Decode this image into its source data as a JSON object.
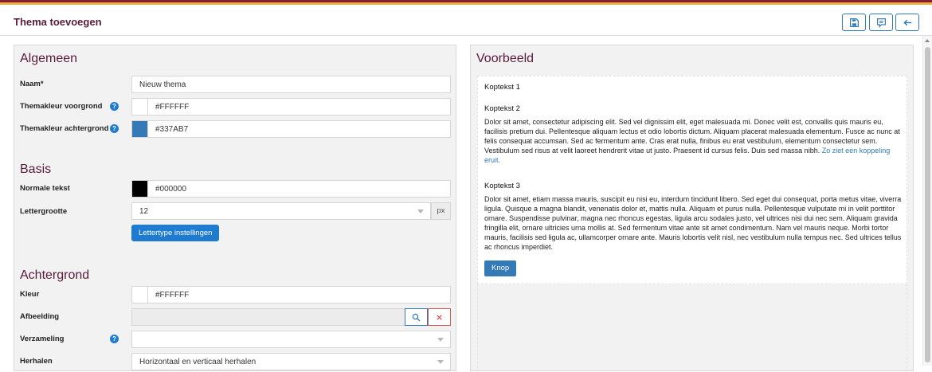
{
  "header": {
    "title": "Thema toevoegen",
    "buttons": [
      {
        "icon": "save-icon"
      },
      {
        "icon": "comment-icon"
      },
      {
        "icon": "arrow-left-icon"
      }
    ]
  },
  "colors": {
    "accent": "#337ab7",
    "title": "#5a1a3a",
    "primary_button": "#1f7bd0",
    "remove": "#d9534f"
  },
  "left_panel": {
    "algemeen": {
      "title": "Algemeen",
      "naam_label": "Naam*",
      "naam_value": "Nieuw thema",
      "voorgrond_label": "Themakleur voorgrond",
      "voorgrond_value": "#FFFFFF",
      "achtergrond_label": "Themakleur achtergrond",
      "achtergrond_value": "#337AB7"
    },
    "basis": {
      "title": "Basis",
      "normale_tekst_label": "Normale tekst",
      "normale_tekst_value": "#000000",
      "lettergrootte_label": "Lettergrootte",
      "lettergrootte_value": "12",
      "lettergrootte_unit": "px",
      "font_button": "Lettertype instellingen"
    },
    "achtergrond": {
      "title": "Achtergrond",
      "kleur_label": "Kleur",
      "kleur_value": "#FFFFFF",
      "afbeelding_label": "Afbeelding",
      "afbeelding_value": "",
      "verzameling_label": "Verzameling",
      "verzameling_value": "",
      "herhalen_label": "Herhalen",
      "herhalen_value": "Horizontaal en verticaal herhalen"
    },
    "help_glyph": "?"
  },
  "right_panel": {
    "title": "Voorbeeld",
    "koptekst1": "Koptekst 1",
    "koptekst2": "Koptekst 2",
    "paragraph1": "Dolor sit amet, consectetur adipiscing elit. Sed vel dignissim elit, eget malesuada mi. Donec velit est, convallis quis mauris eu, facilisis pretium dui. Pellentesque aliquam lectus et odio lobortis dictum. Aliquam placerat malesuada elementum. Fusce ac nunc at felis consequat accumsan. Sed ac fermentum ante. Cras erat nulla, finibus eu erat vestibulum, elementum consectetur sem. Vestibulum sed risus at velit laoreet hendrerit vitae ut justo. Praesent id cursus felis. Duis sed massa nibh.",
    "link_text": "Zo ziet een koppeling eruit.",
    "koptekst3": "Koptekst 3",
    "paragraph2": "Dolor sit amet, etiam massa mauris, suscipit eu nisi eu, interdum tincidunt libero. Sed eget dui consequat, porta metus vitae, viverra ligula. Quisque a magna blandit, venenatis dolor et, mattis nulla. Aliquam et purus nulla. Pellentesque vulputate mi in velit porttitor ornare. Suspendisse pulvinar, magna nec rhoncus egestas, ligula arcu sodales justo, vel ultrices nisi dui nec sem. Aliquam gravida fringilla elit, ornare ultricies urna mollis at. Sed fermentum vitae ante sit amet condimentum. Nam vel mauris neque. Morbi tortor mauris, facilisis sed ligula ac, ullamcorper ornare ante. Mauris lobortis velit nisl, nec vestibulum nulla tempus nec. Sed ultrices tellus ac rhoncus imperdiet.",
    "button_label": "Knop"
  }
}
